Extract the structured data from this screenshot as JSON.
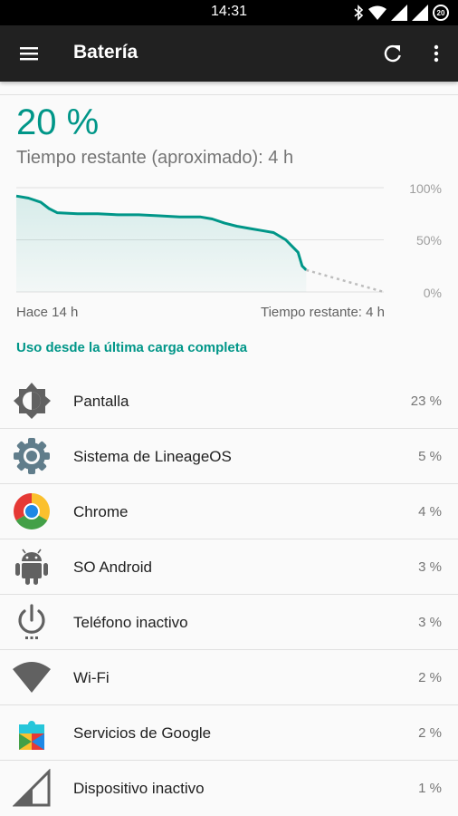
{
  "status_bar": {
    "time": "14:31",
    "battery_level": "20"
  },
  "toolbar": {
    "title": "Batería"
  },
  "battery": {
    "percent": "20 %",
    "remaining": "Tiempo restante (aproximado): 4 h"
  },
  "chart_data": {
    "type": "area",
    "y_ticks": [
      "100%",
      "50%",
      "0%"
    ],
    "xlabel_left": "Hace 14 h",
    "xlabel_right": "Tiempo restante: 4 h",
    "ylim": [
      0,
      100
    ],
    "grid": true,
    "accent": "#009688",
    "series": [
      {
        "x": [
          0,
          0.6,
          1.2,
          1.6,
          2.0,
          3.0,
          4.0,
          5.0,
          6.0,
          7.0,
          8.0,
          9.0,
          9.6,
          10.2,
          10.8,
          11.4,
          12.0,
          12.6,
          13.2,
          13.5,
          13.8,
          14.0,
          14.2
        ],
        "y": [
          92,
          90,
          86,
          80,
          76,
          75,
          75,
          74,
          74,
          73,
          72,
          72,
          70,
          66,
          63,
          61,
          59,
          57,
          50,
          44,
          38,
          25,
          21
        ]
      }
    ],
    "projection": {
      "x": [
        14.2,
        18.0
      ],
      "y": [
        21,
        0
      ]
    },
    "x_range": [
      0,
      18
    ]
  },
  "section": {
    "title": "Uso desde la última carga completa"
  },
  "usage": [
    {
      "label": "Pantalla",
      "value": "23 %",
      "icon": "brightness-icon"
    },
    {
      "label": "Sistema de LineageOS",
      "value": "5 %",
      "icon": "gear-icon"
    },
    {
      "label": "Chrome",
      "value": "4 %",
      "icon": "chrome-icon"
    },
    {
      "label": "SO Android",
      "value": "3 %",
      "icon": "android-icon"
    },
    {
      "label": "Teléfono inactivo",
      "value": "3 %",
      "icon": "power-icon"
    },
    {
      "label": "Wi-Fi",
      "value": "2 %",
      "icon": "wifi-icon"
    },
    {
      "label": "Servicios de Google",
      "value": "2 %",
      "icon": "puzzle-icon"
    },
    {
      "label": "Dispositivo inactivo",
      "value": "1 %",
      "icon": "cell-signal-icon"
    }
  ]
}
